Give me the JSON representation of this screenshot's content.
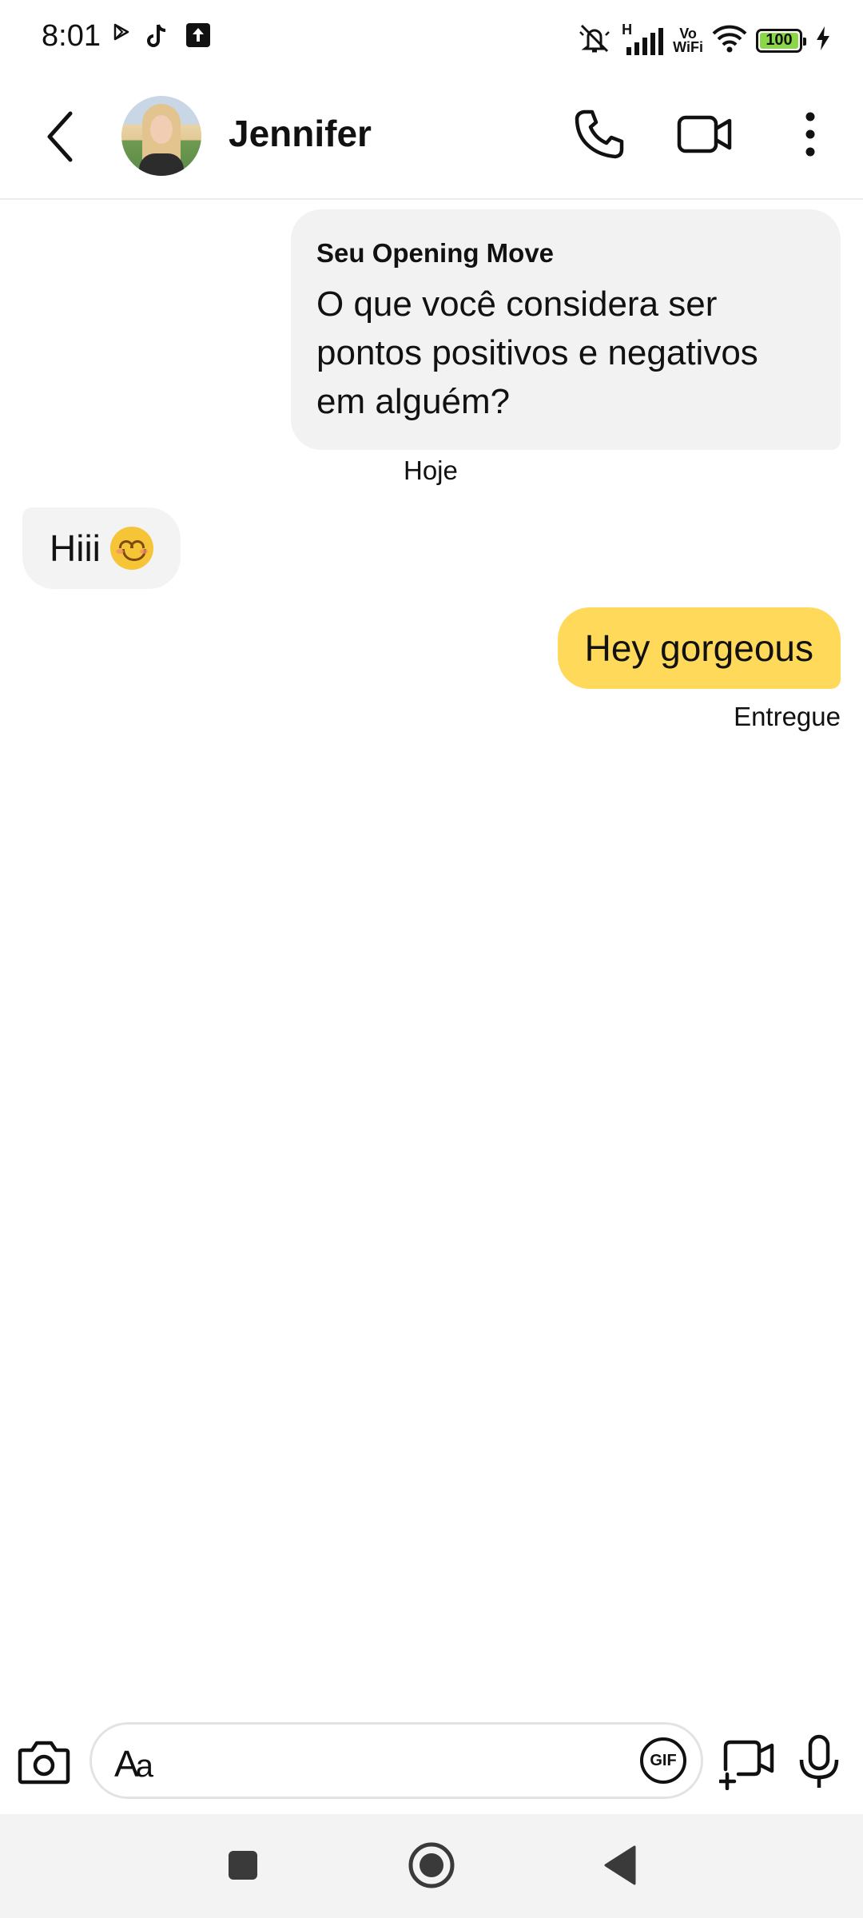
{
  "status_bar": {
    "time": "8:01",
    "network_label": "H",
    "vowifi_line1": "Vo",
    "vowifi_line2": "WiFi",
    "battery": "100",
    "icons": [
      "play-store-icon",
      "tiktok-icon",
      "upload-icon",
      "mute-icon",
      "signal-icon",
      "wifi-icon",
      "battery-icon",
      "charging-icon"
    ]
  },
  "header": {
    "contact_name": "Jennifer",
    "icons": [
      "back-arrow-icon",
      "phone-icon",
      "video-camera-icon",
      "more-vertical-icon"
    ]
  },
  "messages": {
    "opening_move_label": "Seu Opening Move",
    "opening_move_question": "O que você considera ser pontos positivos e negativos em alguém?",
    "day_label": "Hoje",
    "incoming_text": "Hiii",
    "incoming_emoji": "smiling-face-emoji",
    "outgoing_text": "Hey gorgeous",
    "delivery_status": "Entregue"
  },
  "composer": {
    "placeholder": "Aa",
    "gif_label": "GIF",
    "icons": [
      "camera-icon",
      "gif-icon",
      "add-media-icon",
      "microphone-icon"
    ]
  },
  "nav": {
    "icons": [
      "recents-square-icon",
      "home-circle-icon",
      "back-triangle-icon"
    ]
  },
  "colors": {
    "outgoing_bubble": "#ffd95a",
    "incoming_bubble": "#f3f3f3",
    "battery_fill": "#8ad74a"
  }
}
